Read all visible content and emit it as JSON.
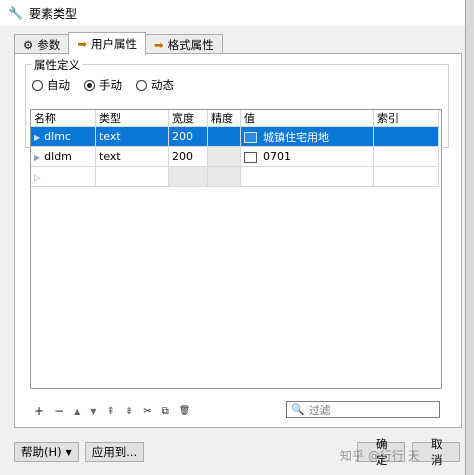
{
  "window": {
    "title": "要素类型"
  },
  "tabs": [
    {
      "label": "参数",
      "icon": "gear-icon"
    },
    {
      "label": "用户属性",
      "icon": "arrow-icon"
    },
    {
      "label": "格式属性",
      "icon": "arrow-icon"
    }
  ],
  "attr_def": {
    "title": "属性定义",
    "options": [
      "自动",
      "手动",
      "动态"
    ],
    "selected": "手动"
  },
  "table": {
    "columns": [
      "名称",
      "类型",
      "宽度",
      "精度",
      "值",
      "索引"
    ],
    "rows": [
      {
        "name": "dlmc",
        "type": "text",
        "width": "200",
        "precision": "",
        "value": "城镇住宅用地",
        "index": ""
      },
      {
        "name": "dldm",
        "type": "text",
        "width": "200",
        "precision": "",
        "value": "0701",
        "index": ""
      }
    ]
  },
  "toolbar": {
    "items": [
      "+",
      "−",
      "▲",
      "▼",
      "⇞",
      "⇟",
      "✂",
      "⧉",
      "🗑"
    ]
  },
  "filter": {
    "placeholder": "过滤"
  },
  "buttons": {
    "help": "帮助(H)",
    "apply": "应用到...",
    "ok": "确定",
    "cancel": "取消"
  },
  "watermark": "知乎 @行行 天"
}
